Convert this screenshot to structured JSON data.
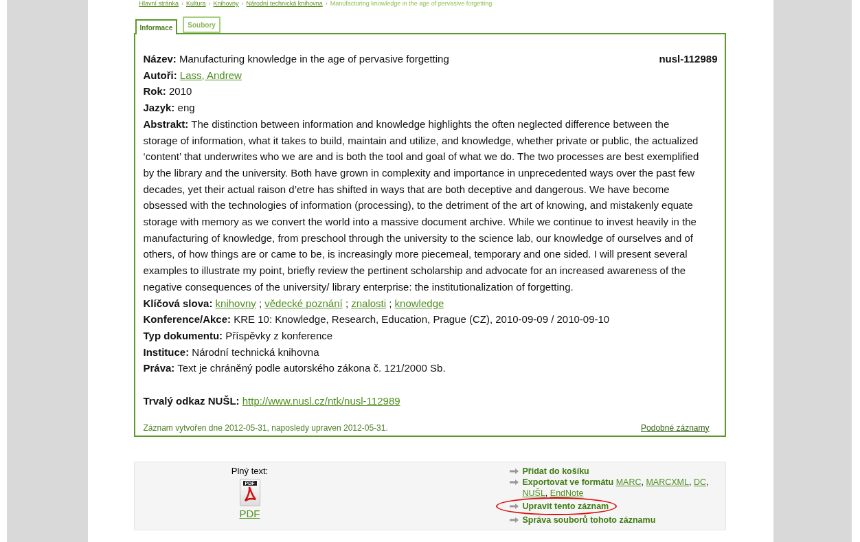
{
  "breadcrumb_separator": "›",
  "breadcrumb": [
    {
      "label": "Hlavní stránka",
      "link": true
    },
    {
      "label": "Kultura",
      "link": true
    },
    {
      "label": "Knihovny",
      "link": true
    },
    {
      "label": "Národní technická knihovna",
      "link": true
    },
    {
      "label": "Manufacturing knowledge in the age of pervasive forgetting",
      "link": false
    }
  ],
  "tabs": [
    {
      "label": "Informace",
      "selected": true
    },
    {
      "label": "Soubory",
      "selected": false
    }
  ],
  "record": {
    "id": "nusl-112989",
    "fields": [
      {
        "label": "Název:",
        "kind": "text",
        "value": "Manufacturing knowledge in the age of pervasive forgetting"
      },
      {
        "label": "Autoři:",
        "kind": "links",
        "links": [
          "Lass, Andrew"
        ]
      },
      {
        "label": "Rok:",
        "kind": "text",
        "value": "2010"
      },
      {
        "label": "Jazyk:",
        "kind": "text",
        "value": "eng"
      },
      {
        "label": "Abstrakt:",
        "kind": "text",
        "value": "The distinction between information and knowledge highlights the often neglected difference between the storage of information, what it takes to build, maintain and utilize, and knowledge, whether private or public, the actualized ‘content’ that underwrites who we are and is both the tool and goal of what we do. The two processes are best exemplified by the library and the university. Both have grown in complexity and importance in unprecedented ways over the past few decades, yet their actual raison d’etre has shifted in ways that are both deceptive and dangerous. We have become obsessed with the technologies of information (processing), to the detriment of the art of knowing, and mistakenly equate storage with memory as we convert the world into a massive document archive. While we continue to invest heavily in the manufacturing of knowledge, from preschool through the university to the science lab, our knowledge of ourselves and of others, of how things are or came to be, is increasingly more piecemeal, temporary and one sided. I will present several examples to illustrate my point, briefly review the pertinent scholarship and advocate for an increased awareness of the negative consequences of the university/ library enterprise: the institutionalization of forgetting."
      },
      {
        "label": "Klíčová slova:",
        "kind": "links",
        "separator": ";",
        "links": [
          "knihovny",
          "vědecké poznání",
          "znalosti",
          "knowledge"
        ]
      },
      {
        "label": "Konference/Akce:",
        "kind": "text",
        "value": "KRE 10: Knowledge, Research, Education, Prague (CZ), 2010-09-09 / 2010-09-10"
      },
      {
        "label": "Typ dokumentu:",
        "kind": "text",
        "value": "Příspěvky z konference"
      },
      {
        "label": "Instituce:",
        "kind": "text",
        "value": "Národní technická knihovna"
      },
      {
        "label": "Práva:",
        "kind": "text",
        "value": "Text je chráněný podle autorského zákona č. 121/2000 Sb."
      }
    ],
    "permalink": {
      "label": "Trvalý odkaz NUŠL:",
      "url": "http://www.nusl.cz/ntk/nusl-112989"
    },
    "footer": {
      "created": "Záznam vytvořen dne 2012-05-31, naposledy upraven 2012-05-31.",
      "similar": "Podobné záznamy"
    }
  },
  "fulltext": {
    "label": "Plný text:",
    "icon_label": "PDF",
    "link": "PDF"
  },
  "actions": [
    {
      "label": "Přidat do košíku",
      "highlighted": false
    },
    {
      "label": "Exportovat ve formátu",
      "format_separator": ",",
      "formats": [
        "MARC",
        "MARCXML",
        "DC",
        "NUŠL",
        "EndNote"
      ],
      "highlighted": false
    },
    {
      "label": "Upravit tento záznam",
      "highlighted": true
    },
    {
      "label": "Správa souborů tohoto záznamu",
      "highlighted": false
    }
  ]
}
